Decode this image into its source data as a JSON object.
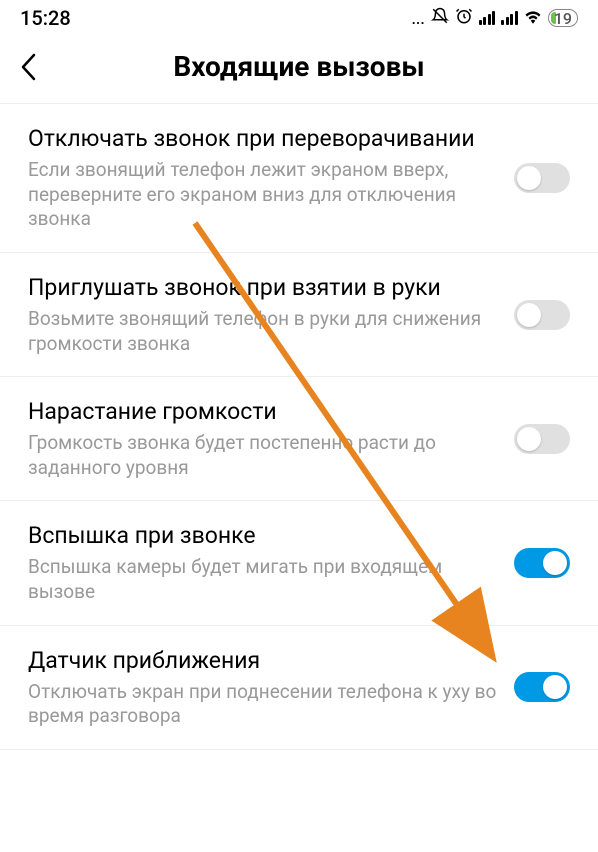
{
  "status": {
    "time": "15:28",
    "dots": "...",
    "battery": "19"
  },
  "header": {
    "title": "Входящие вызовы"
  },
  "settings": [
    {
      "title": "Отключать звонок при переворачивании",
      "subtitle": "Если звонящий телефон лежит экраном вверх, переверните его экраном вниз для отключения звонка",
      "on": false
    },
    {
      "title": "Приглушать звонок при взятии в руки",
      "subtitle": "Возьмите звонящий телефон в руки для снижения громкости звонка",
      "on": false
    },
    {
      "title": "Нарастание громкости",
      "subtitle": "Громкость звонка будет постепенно расти до заданного уровня",
      "on": false
    },
    {
      "title": "Вспышка при звонке",
      "subtitle": "Вспышка камеры будет мигать при входящем вызове",
      "on": true
    },
    {
      "title": "Датчик приближения",
      "subtitle": "Отключать экран при поднесении телефона к уху во время разговора",
      "on": true
    }
  ]
}
